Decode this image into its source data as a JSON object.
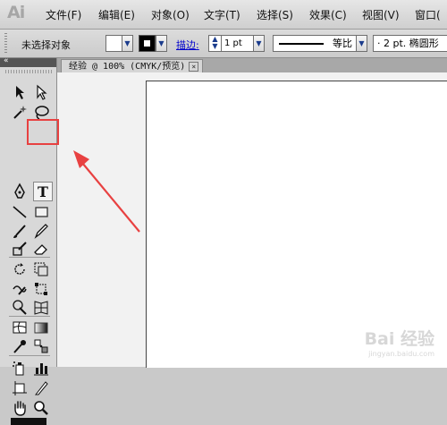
{
  "app": {
    "logo": "Ai"
  },
  "menu": [
    {
      "label": "文件(F)"
    },
    {
      "label": "编辑(E)"
    },
    {
      "label": "对象(O)"
    },
    {
      "label": "文字(T)"
    },
    {
      "label": "选择(S)"
    },
    {
      "label": "效果(C)"
    },
    {
      "label": "视图(V)"
    },
    {
      "label": "窗口("
    }
  ],
  "control_bar": {
    "selection_status": "未选择对象",
    "stroke_label": "描边:",
    "stroke_weight": "1 pt",
    "stroke_profile": "等比",
    "brush_definition": "· 2 pt. 椭圆形"
  },
  "tools_panel": {
    "collapse_icon": "«"
  },
  "document_tab": {
    "title": "经验 @ 100% (CMYK/预览)",
    "close_glyph": "×"
  },
  "annotation": {
    "color": "#e84141"
  },
  "watermark": {
    "main": "Bai 经验",
    "sub": "jingyan.baidu.com"
  },
  "icons": [
    "selection-tool-icon",
    "direct-selection-tool-icon",
    "magic-wand-tool-icon",
    "lasso-tool-icon",
    "pen-tool-icon",
    "type-tool-icon",
    "line-segment-tool-icon",
    "rectangle-tool-icon",
    "paintbrush-tool-icon",
    "pencil-tool-icon",
    "blob-brush-tool-icon",
    "eraser-tool-icon",
    "rotate-tool-icon",
    "scale-tool-icon",
    "warp-tool-icon",
    "free-transform-tool-icon",
    "shape-builder-tool-icon",
    "perspective-grid-tool-icon",
    "mesh-tool-icon",
    "gradient-tool-icon",
    "eyedropper-tool-icon",
    "blend-tool-icon",
    "symbol-sprayer-tool-icon",
    "column-graph-tool-icon",
    "artboard-tool-icon",
    "slice-tool-icon",
    "hand-tool-icon",
    "zoom-tool-icon"
  ]
}
